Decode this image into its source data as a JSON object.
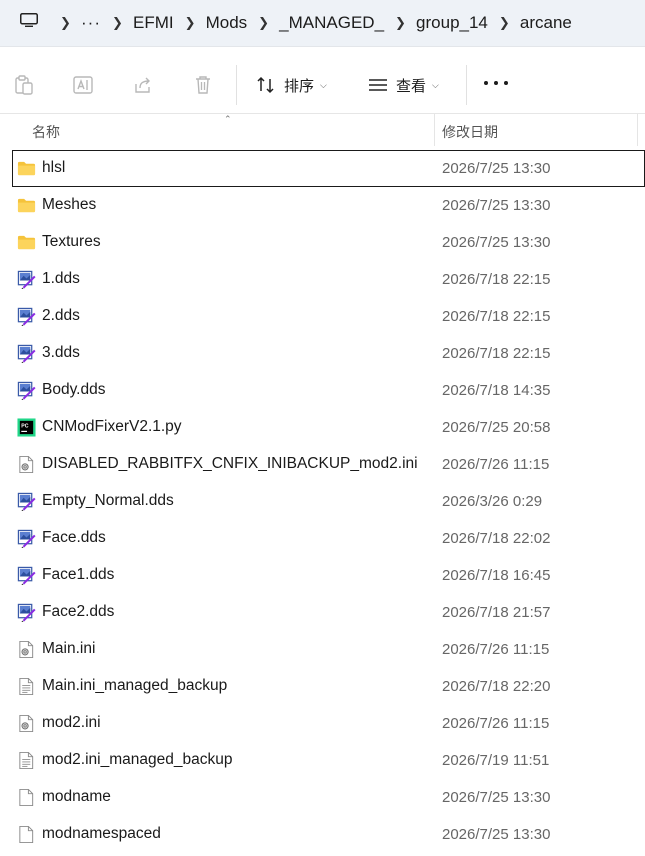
{
  "address": {
    "overflow": "···",
    "crumbs": [
      "EFMI",
      "Mods",
      "_MANAGED_",
      "group_14",
      "arcane"
    ]
  },
  "toolbar": {
    "sort_label": "排序",
    "view_label": "查看"
  },
  "columns": {
    "name": "名称",
    "date": "修改日期"
  },
  "files": [
    {
      "name": "hlsl",
      "date": "2026/7/25 13:30",
      "icon": "folder"
    },
    {
      "name": "Meshes",
      "date": "2026/7/25 13:30",
      "icon": "folder"
    },
    {
      "name": "Textures",
      "date": "2026/7/25 13:30",
      "icon": "folder"
    },
    {
      "name": "1.dds",
      "date": "2026/7/18 22:15",
      "icon": "dds"
    },
    {
      "name": "2.dds",
      "date": "2026/7/18 22:15",
      "icon": "dds"
    },
    {
      "name": "3.dds",
      "date": "2026/7/18 22:15",
      "icon": "dds"
    },
    {
      "name": "Body.dds",
      "date": "2026/7/18 14:35",
      "icon": "dds"
    },
    {
      "name": "CNModFixerV2.1.py",
      "date": "2026/7/25 20:58",
      "icon": "pycharm"
    },
    {
      "name": "DISABLED_RABBITFX_CNFIX_INIBACKUP_mod2.ini",
      "date": "2026/7/26 11:15",
      "icon": "ini"
    },
    {
      "name": "Empty_Normal.dds",
      "date": "2026/3/26 0:29",
      "icon": "dds"
    },
    {
      "name": "Face.dds",
      "date": "2026/7/18 22:02",
      "icon": "dds"
    },
    {
      "name": "Face1.dds",
      "date": "2026/7/18 16:45",
      "icon": "dds"
    },
    {
      "name": "Face2.dds",
      "date": "2026/7/18 21:57",
      "icon": "dds"
    },
    {
      "name": "Main.ini",
      "date": "2026/7/26 11:15",
      "icon": "ini"
    },
    {
      "name": "Main.ini_managed_backup",
      "date": "2026/7/18 22:20",
      "icon": "text"
    },
    {
      "name": "mod2.ini",
      "date": "2026/7/26 11:15",
      "icon": "ini"
    },
    {
      "name": "mod2.ini_managed_backup",
      "date": "2026/7/19 11:51",
      "icon": "text"
    },
    {
      "name": "modname",
      "date": "2026/7/25 13:30",
      "icon": "blank"
    },
    {
      "name": "modnamespaced",
      "date": "2026/7/25 13:30",
      "icon": "blank"
    }
  ],
  "selected_index": 0,
  "colors": {
    "folder": "#f5c33b",
    "accent": "#1a1a1a",
    "address_bg": "#eef2f7"
  }
}
